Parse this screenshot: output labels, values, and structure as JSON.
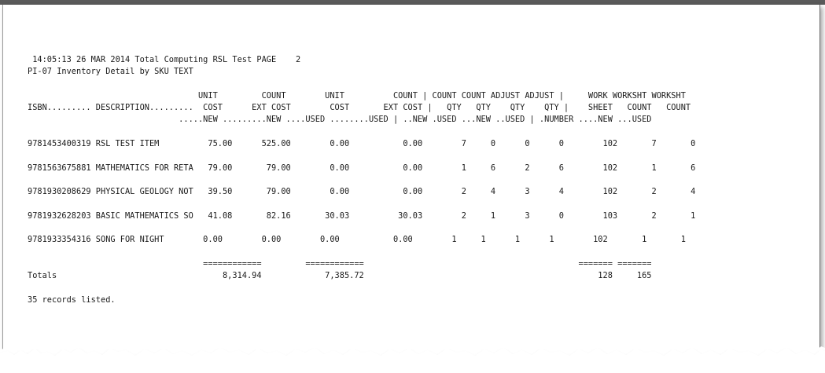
{
  "report": {
    "header_line": " 14:05:13 26 MAR 2014 Total Computing RSL Test PAGE    2",
    "title_line": "PI-07 Inventory Detail by SKU TEXT",
    "column_header_lines": [
      "                                   UNIT         COUNT        UNIT          COUNT | COUNT COUNT ADJUST ADJUST |     WORK WORKSHT WORKSHT",
      "ISBN......... DESCRIPTION.........  COST      EXT COST        COST       EXT COST |   QTY   QTY    QTY    QTY |    SHEET   COUNT   COUNT",
      "                               .....NEW .........NEW ....USED ........USED | ..NEW .USED ...NEW ..USED | .NUMBER ....NEW ...USED"
    ],
    "columns": [
      {
        "name": "ISBN",
        "header": "ISBN........."
      },
      {
        "name": "DESCRIPTION",
        "header": "DESCRIPTION........."
      },
      {
        "name": "UNIT COST NEW",
        "header": "UNIT COST .....NEW"
      },
      {
        "name": "COUNT EXT COST NEW",
        "header": "COUNT EXT COST .........NEW"
      },
      {
        "name": "UNIT COST USED",
        "header": "UNIT COST ....USED"
      },
      {
        "name": "COUNT EXT COST USED",
        "header": "COUNT EXT COST ........USED"
      },
      {
        "name": "COUNT QTY NEW",
        "header": "COUNT QTY ..NEW"
      },
      {
        "name": "COUNT QTY USED",
        "header": "COUNT QTY .USED"
      },
      {
        "name": "ADJUST QTY NEW",
        "header": "ADJUST QTY ...NEW"
      },
      {
        "name": "ADJUST QTY USED",
        "header": "ADJUST QTY ..USED"
      },
      {
        "name": "WORK SHEET NUMBER",
        "header": "WORK SHEET .NUMBER"
      },
      {
        "name": "WORKSHT COUNT NEW",
        "header": "WORKSHT COUNT ....NEW"
      },
      {
        "name": "WORKSHT COUNT USED",
        "header": "WORKSHT COUNT ...USED"
      }
    ],
    "rows": [
      {
        "isbn": "9781453400319",
        "description": "RSL TEST ITEM",
        "unit_cost_new": "75.00",
        "ext_cost_new": "525.00",
        "unit_cost_used": "0.00",
        "ext_cost_used": "0.00",
        "count_qty_new": "7",
        "count_qty_used": "0",
        "adjust_qty_new": "0",
        "adjust_qty_used": "0",
        "work_sheet_number": "102",
        "worksht_count_new": "7",
        "worksht_count_used": "0",
        "line": "9781453400319 RSL TEST ITEM          75.00      525.00        0.00           0.00        7     0      0      0        102       7       0"
      },
      {
        "isbn": "9781563675881",
        "description": "MATHEMATICS FOR RETA",
        "unit_cost_new": "79.00",
        "ext_cost_new": "79.00",
        "unit_cost_used": "0.00",
        "ext_cost_used": "0.00",
        "count_qty_new": "1",
        "count_qty_used": "6",
        "adjust_qty_new": "2",
        "adjust_qty_used": "6",
        "work_sheet_number": "102",
        "worksht_count_new": "1",
        "worksht_count_used": "6",
        "line": "9781563675881 MATHEMATICS FOR RETA   79.00       79.00        0.00           0.00        1     6      2      6        102       1       6"
      },
      {
        "isbn": "9781930208629",
        "description": "PHYSICAL GEOLOGY NOT",
        "unit_cost_new": "39.50",
        "ext_cost_new": "79.00",
        "unit_cost_used": "0.00",
        "ext_cost_used": "0.00",
        "count_qty_new": "2",
        "count_qty_used": "4",
        "adjust_qty_new": "3",
        "adjust_qty_used": "4",
        "work_sheet_number": "102",
        "worksht_count_new": "2",
        "worksht_count_used": "4",
        "line": "9781930208629 PHYSICAL GEOLOGY NOT   39.50       79.00        0.00           0.00        2     4      3      4        102       2       4"
      },
      {
        "isbn": "9781932628203",
        "description": "BASIC MATHEMATICS SO",
        "unit_cost_new": "41.08",
        "ext_cost_new": "82.16",
        "unit_cost_used": "30.03",
        "ext_cost_used": "30.03",
        "count_qty_new": "2",
        "count_qty_used": "1",
        "adjust_qty_new": "3",
        "adjust_qty_used": "0",
        "work_sheet_number": "103",
        "worksht_count_new": "2",
        "worksht_count_used": "1",
        "line": "9781932628203 BASIC MATHEMATICS SO   41.08       82.16       30.03          30.03        2     1      3      0        103       2       1"
      },
      {
        "isbn": "9781933354316",
        "description": "SONG FOR NIGHT",
        "unit_cost_new": "0.00",
        "ext_cost_new": "0.00",
        "unit_cost_used": "0.00",
        "ext_cost_used": "0.00",
        "count_qty_new": "1",
        "count_qty_used": "1",
        "adjust_qty_new": "1",
        "adjust_qty_used": "1",
        "work_sheet_number": "102",
        "worksht_count_new": "1",
        "worksht_count_used": "1",
        "line": "9781933354316 SONG FOR NIGHT        0.00        0.00        0.00           0.00        1     1      1      1        102       1       1"
      }
    ],
    "separator_line": "                                    ============         ============                                            ======= =======",
    "totals": {
      "label": "Totals",
      "ext_cost_new": "8,314.94",
      "ext_cost_used": "7,385.72",
      "worksht_count_new": "128",
      "worksht_count_used": "165",
      "line": "Totals                                  8,314.94             7,385.72                                                128     165"
    },
    "footer": "35 records listed."
  }
}
